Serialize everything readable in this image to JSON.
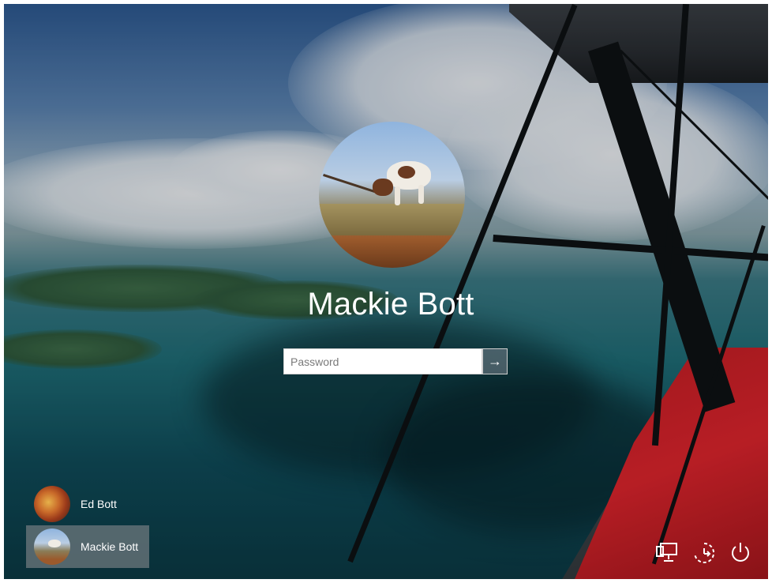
{
  "user": {
    "name": "Mackie Bott"
  },
  "password": {
    "placeholder": "Password",
    "submit_glyph": "→"
  },
  "accounts": [
    {
      "name": "Ed Bott",
      "selected": false
    },
    {
      "name": "Mackie Bott",
      "selected": true
    }
  ],
  "tray": {
    "icons": [
      "network-icon",
      "ease-of-access-icon",
      "power-icon"
    ]
  },
  "colors": {
    "accent_overlay": "#6e787d",
    "text": "#ffffff"
  }
}
